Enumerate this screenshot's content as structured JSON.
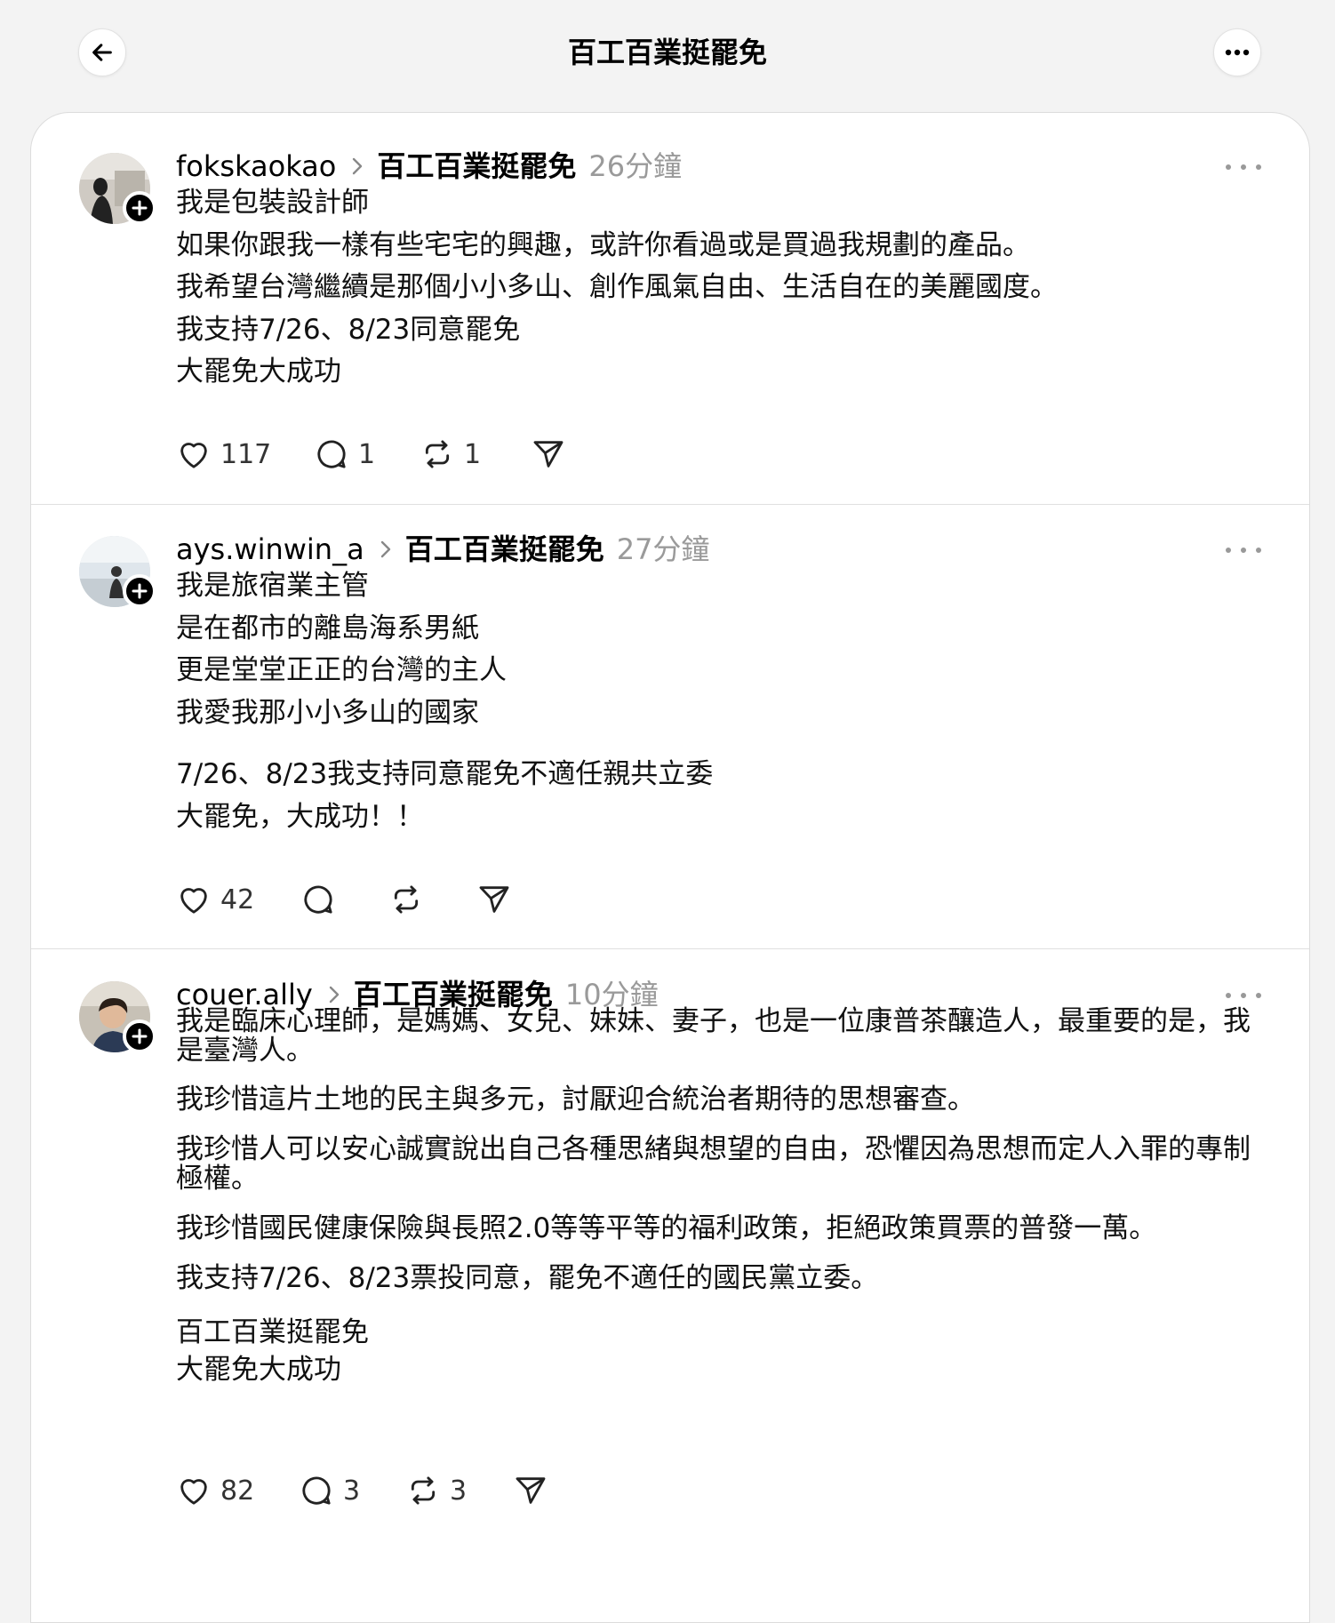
{
  "header": {
    "title": "百工百業挺罷免"
  },
  "posts": [
    {
      "username": "fokskaokao",
      "community": "百工百業挺罷免",
      "time": "26分鐘",
      "lines": [
        "我是包裝設計師",
        "如果你跟我一樣有些宅宅的興趣，或許你看過或是買過我規劃的產品。",
        "我希望台灣繼續是那個小小多山、創作風氣自由、生活自在的美麗國度。",
        "我支持7/26、8/23同意罷免",
        "大罷免大成功"
      ],
      "likes": "117",
      "replies": "1",
      "reposts": "1"
    },
    {
      "username": "ays.winwin_a",
      "community": "百工百業挺罷免",
      "time": "27分鐘",
      "lines": [
        "我是旅宿業主管",
        "是在都市的離島海系男紙",
        "更是堂堂正正的台灣的主人",
        "我愛我那小小多山的國家"
      ],
      "lines2": [
        "7/26、8/23我支持同意罷免不適任親共立委",
        "大罷免，大成功！！"
      ],
      "likes": "42",
      "replies": "",
      "reposts": ""
    },
    {
      "username": "couer.ally",
      "community": "百工百業挺罷免",
      "time": "10分鐘",
      "paragraphs": [
        "我是臨床心理師，是媽媽、女兒、妹妹、妻子，也是一位康普茶釀造人，最重要的是，我是臺灣人。",
        "我珍惜這片土地的民主與多元，討厭迎合統治者期待的思想審查。",
        "我珍惜人可以安心誠實說出自己各種思緒與想望的自由，恐懼因為思想而定人入罪的專制極權。",
        "我珍惜國民健康保險與長照2.0等等平等的福利政策，拒絕政策買票的普發一萬。",
        "我支持7/26、8/23票投同意，罷免不適任的國民黨立委。"
      ],
      "closing": [
        "百工百業挺罷免",
        "大罷免大成功"
      ],
      "likes": "82",
      "replies": "3",
      "reposts": "3"
    }
  ],
  "icons": {
    "back": "arrow-left-icon",
    "more": "more-horizontal-icon",
    "like": "heart-icon",
    "reply": "comment-icon",
    "repost": "repost-icon",
    "share": "send-icon",
    "follow": "plus-icon"
  }
}
